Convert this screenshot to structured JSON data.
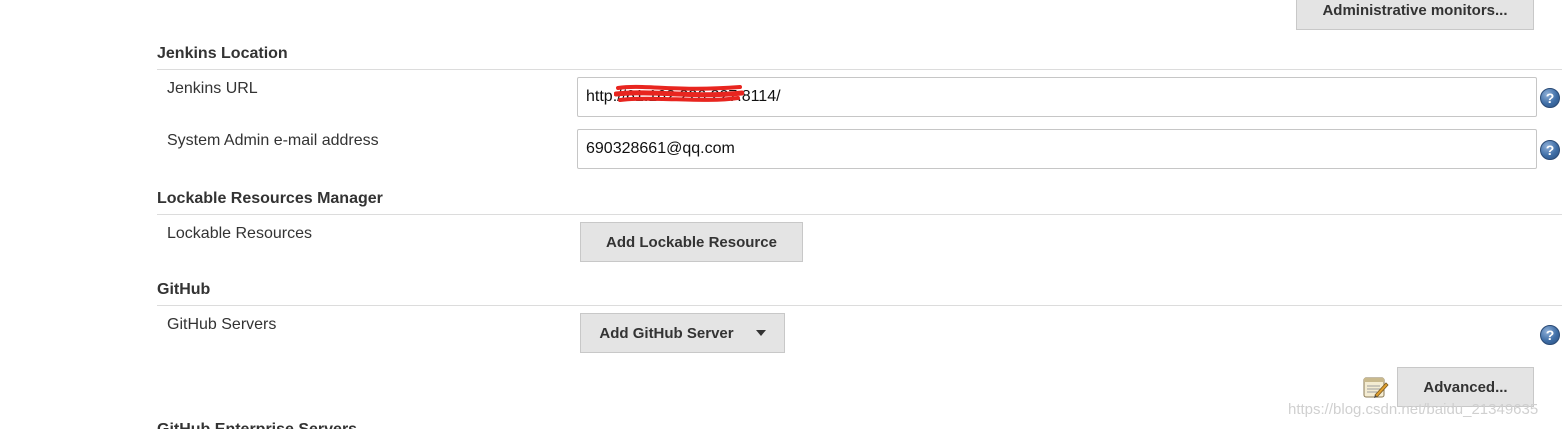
{
  "top_button": {
    "label": "Administrative monitors..."
  },
  "sections": {
    "jenkins_location": {
      "title": "Jenkins Location",
      "url_label": "Jenkins URL",
      "url_value": "http://61.162.226.227:8114/",
      "email_label": "System Admin e-mail address",
      "email_value": "690328661@qq.com"
    },
    "lockable": {
      "title": "Lockable Resources Manager",
      "label": "Lockable Resources",
      "button": "Add Lockable Resource"
    },
    "github": {
      "title": "GitHub",
      "servers_label": "GitHub Servers",
      "add_button": "Add GitHub Server",
      "advanced_button": "Advanced..."
    },
    "github_enterprise": {
      "title": "GitHub Enterprise Servers"
    }
  },
  "help_symbol": "?",
  "watermark": "https://blog.csdn.net/baidu_21349635",
  "icons": {
    "help": "help-icon",
    "edit": "notepad-icon",
    "dropdown": "chevron-down-icon"
  },
  "colors": {
    "button_bg": "#e4e4e4",
    "help_blue": "#3f6ea6",
    "redaction": "#e8251f"
  }
}
